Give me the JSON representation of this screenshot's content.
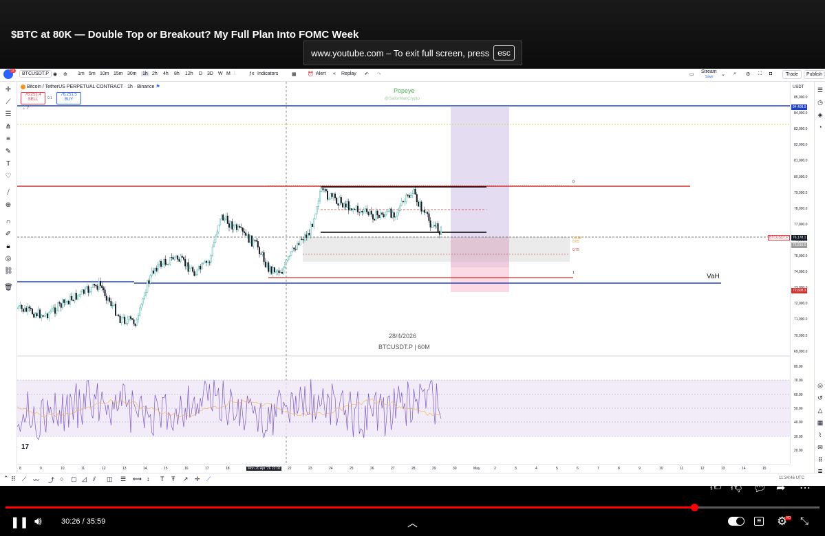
{
  "video": {
    "title": "$BTC at 80K — Double Top or Breakout? My Full Plan Into FOMC Week",
    "fullscreen_notice": "www.youtube.com – To exit full screen, press",
    "esc_key": "esc",
    "time_display": "30:26 / 35:59",
    "progress": 0.846,
    "settings_badge": "HD"
  },
  "toolbar": {
    "symbol": "BTCUSDT.P",
    "intervals": [
      "1m",
      "5m",
      "10m",
      "15m",
      "30m",
      "1h",
      "2h",
      "4h",
      "8h",
      "12h",
      "D",
      "3D",
      "W",
      "M"
    ],
    "active_interval": "1h",
    "indicators": "Indicators",
    "alert": "Alert",
    "replay": "Replay",
    "stream": "Stream",
    "stream_sub": "Save",
    "trade": "Trade",
    "publish": "Publish",
    "notif_count": "11"
  },
  "legend": {
    "title": "Bitcoin / TetherUS PERPETUAL CONTRACT · 1h · Binance",
    "sell_price": "76,251.4",
    "sell_label": "SELL",
    "spread": "0.1",
    "buy_price": "76,251.5",
    "buy_label": "BUY",
    "collapse": "7"
  },
  "watermarks": {
    "name": "Popeye",
    "handle": "@SailorManCrypto",
    "date": "28/4/2026",
    "symbol": "BTCUSDT.P | 60M"
  },
  "annotations": {
    "vah": "VaH",
    "fib_0": "0",
    "fib_618": "0.618",
    "fib_65": "0.65",
    "fib_75": "0.75",
    "fib_1": "1"
  },
  "price_scale": {
    "currency": "USDT",
    "labels": [
      "85,000.0",
      "84,000.0",
      "83,000.0",
      "82,000.0",
      "81,000.0",
      "80,000.0",
      "79,000.0",
      "78,000.0",
      "77,000.0",
      "76,000.0",
      "75,000.0",
      "74,000.0",
      "73,000.0",
      "72,000.0",
      "71,000.0",
      "70,000.0",
      "69,000.0"
    ],
    "tag_top": "84,408.9",
    "tag_current": "76,178.1",
    "tag_grey": "75,810.6",
    "tag_red": "72,608.3",
    "symbol_tag": "BTCUSDT.P"
  },
  "rsi_scale": [
    "80.00",
    "70.00",
    "60.00",
    "50.00",
    "40.00",
    "30.00",
    "20.00"
  ],
  "time_axis": {
    "labels": [
      "8",
      "9",
      "10",
      "11",
      "12",
      "13",
      "14",
      "15",
      "16",
      "17",
      "18",
      "19",
      "Mon 20 Apr '26   22:00",
      "22",
      "23",
      "24",
      "25",
      "26",
      "27",
      "28",
      "29",
      "30",
      "May",
      "2",
      "3",
      "4",
      "5",
      "6",
      "7",
      "8",
      "9",
      "10",
      "11",
      "12",
      "13",
      "14",
      "15"
    ],
    "clock": "11:34:46 UTC"
  },
  "colors": {
    "resistance_red": "#d32f2f",
    "support_blue": "#1e3fbf",
    "rsi_purple": "#7e57c2",
    "price_line": "#131722",
    "youtube_red": "#ff0000"
  }
}
